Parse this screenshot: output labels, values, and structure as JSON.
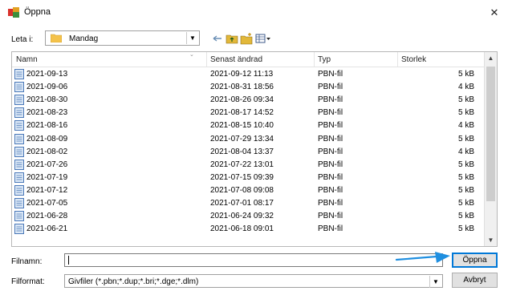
{
  "window": {
    "title": "Öppna",
    "close_glyph": "✕",
    "accent": "#0078d7"
  },
  "lookin": {
    "label": "Leta i:",
    "folder": "Mandag"
  },
  "columns": {
    "name": "Namn",
    "modified": "Senast ändrad",
    "type": "Typ",
    "size": "Storlek"
  },
  "files": [
    {
      "name": "2021-09-13",
      "modified": "2021-09-12 11:13",
      "type": "PBN-fil",
      "size": "5 kB"
    },
    {
      "name": "2021-09-06",
      "modified": "2021-08-31 18:56",
      "type": "PBN-fil",
      "size": "4 kB"
    },
    {
      "name": "2021-08-30",
      "modified": "2021-08-26 09:34",
      "type": "PBN-fil",
      "size": "5 kB"
    },
    {
      "name": "2021-08-23",
      "modified": "2021-08-17 14:52",
      "type": "PBN-fil",
      "size": "5 kB"
    },
    {
      "name": "2021-08-16",
      "modified": "2021-08-15 10:40",
      "type": "PBN-fil",
      "size": "4 kB"
    },
    {
      "name": "2021-08-09",
      "modified": "2021-07-29 13:34",
      "type": "PBN-fil",
      "size": "5 kB"
    },
    {
      "name": "2021-08-02",
      "modified": "2021-08-04 13:37",
      "type": "PBN-fil",
      "size": "4 kB"
    },
    {
      "name": "2021-07-26",
      "modified": "2021-07-22 13:01",
      "type": "PBN-fil",
      "size": "5 kB"
    },
    {
      "name": "2021-07-19",
      "modified": "2021-07-15 09:39",
      "type": "PBN-fil",
      "size": "5 kB"
    },
    {
      "name": "2021-07-12",
      "modified": "2021-07-08 09:08",
      "type": "PBN-fil",
      "size": "5 kB"
    },
    {
      "name": "2021-07-05",
      "modified": "2021-07-01 08:17",
      "type": "PBN-fil",
      "size": "5 kB"
    },
    {
      "name": "2021-06-28",
      "modified": "2021-06-24 09:32",
      "type": "PBN-fil",
      "size": "5 kB"
    },
    {
      "name": "2021-06-21",
      "modified": "2021-06-18 09:01",
      "type": "PBN-fil",
      "size": "5 kB"
    }
  ],
  "filename": {
    "label": "Filnamn:",
    "value": ""
  },
  "filetype": {
    "label": "Filformat:",
    "value": "Givfiler (*.pbn;*.dup;*.bri;*.dge;*.dlm)"
  },
  "buttons": {
    "open": "Öppna",
    "cancel": "Avbryt"
  }
}
